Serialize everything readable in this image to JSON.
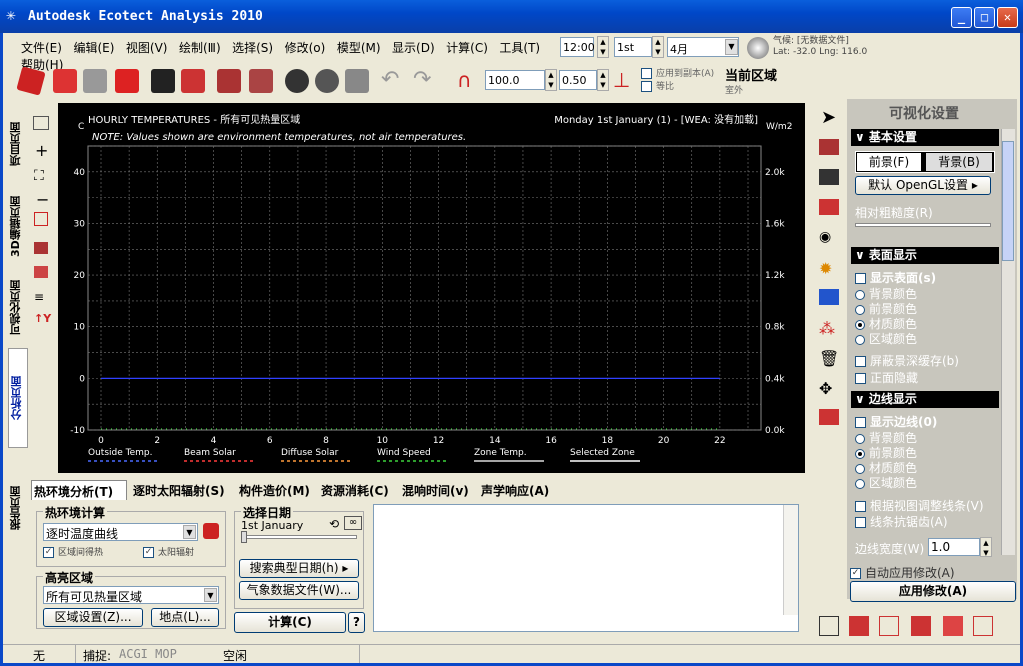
{
  "window": {
    "title": "Autodesk Ecotect Analysis 2010",
    "min": "_",
    "max": "□",
    "close": "✕"
  },
  "menu": [
    "文件(E)",
    "编辑(E)",
    "视图(V)",
    "绘制(Ⅲ)",
    "选择(S)",
    "修改(o)",
    "模型(M)",
    "显示(D)",
    "计算(C)",
    "工具(T)",
    "帮助(H)"
  ],
  "time": {
    "hour": "12:00",
    "day": "1st",
    "month": "4月"
  },
  "weather": {
    "line1": "气候: [无数据文件]",
    "line2": "Lat: -32.0   Lng: 116.0"
  },
  "toolbar2": {
    "value1": "100.0",
    "value2": "0.50",
    "opt1": "应用到副本(A)",
    "opt2": "等比",
    "zone_label": "当前区域",
    "zone_sub": "室外"
  },
  "left_tabs": [
    "项目页面",
    "3D编辑页面",
    "可视化页面",
    "分析页面",
    "报告页面"
  ],
  "chart": {
    "title": "HOURLY TEMPERATURES - 所有可见热量区域",
    "date": "Monday 1st January (1) - [WEA: 没有加载]",
    "note": "NOTE: Values shown are environment temperatures, not air temperatures.",
    "yunit_left": "C",
    "yunit_right": "W/m2",
    "left_ticks": [
      "40",
      "30",
      "20",
      "10",
      "0",
      "-10"
    ],
    "right_ticks": [
      "2.0k",
      "1.6k",
      "1.2k",
      "0.8k",
      "0.4k",
      "0.0k"
    ],
    "x_ticks": [
      "0",
      "2",
      "4",
      "6",
      "8",
      "10",
      "12",
      "14",
      "16",
      "18",
      "20",
      "22"
    ],
    "legend": [
      {
        "name": "Outside Temp.",
        "color": "#4a6bff"
      },
      {
        "name": "Beam Solar",
        "color": "#ff3c3c"
      },
      {
        "name": "Diffuse Solar",
        "color": "#ff9a3c"
      },
      {
        "name": "Wind Speed",
        "color": "#3cd23c"
      },
      {
        "name": "Zone Temp.",
        "color": "#dcdcdc"
      },
      {
        "name": "Selected Zone",
        "color": "#ffffff"
      }
    ]
  },
  "chart_data": {
    "type": "line",
    "title": "HOURLY TEMPERATURES - 所有可见热量区域",
    "x": [
      0,
      2,
      4,
      6,
      8,
      10,
      12,
      14,
      16,
      18,
      20,
      22
    ],
    "ylim": [
      -10,
      45
    ],
    "y2lim": [
      0,
      2200
    ],
    "series": [
      {
        "name": "Outside Temp.",
        "values": [
          0,
          0,
          0,
          0,
          0,
          0,
          0,
          0,
          0,
          0,
          0,
          0
        ]
      },
      {
        "name": "Wind Speed",
        "values": [
          0,
          0,
          0,
          0,
          0,
          0,
          0,
          0,
          0,
          0,
          0,
          0
        ]
      }
    ]
  },
  "bottom_tabs": [
    "热环境分析(T)",
    "逐时太阳辐射(S)",
    "构件造价(M)",
    "资源消耗(C)",
    "混响时间(v)",
    "声学响应(A)"
  ],
  "thermal": {
    "label": "热环境计算",
    "select": "逐时温度曲线",
    "chk1": "区域间得热",
    "chk2": "太阳辐射"
  },
  "highlight": {
    "label": "高亮区域",
    "select": "所有可见热量区域",
    "btn1": "区域设置(Z)...",
    "btn2": "地点(L)..."
  },
  "date_sel": {
    "label": "选择日期",
    "date": "1st January",
    "btn1": "搜索典型日期(h)",
    "btn2": "气象数据文件(W)...",
    "calc": "计算(C)",
    "help": "?"
  },
  "right_panel": {
    "title": "可视化设置",
    "basic": "基本设置",
    "fg": "前景(F)",
    "bg": "背景(B)",
    "opengl": "默认 OpenGL设置",
    "rough": "相对粗糙度(R)",
    "surface": "表面显示",
    "show_surface": "显示表面(s)",
    "s_opts": [
      "背景颜色",
      "前景颜色",
      "材质颜色",
      "区域颜色"
    ],
    "depth": "屏蔽景深缓存(b)",
    "front": "正面隐藏",
    "edge": "边线显示",
    "show_edge": "显示边线(0)",
    "e_opts": [
      "背景颜色",
      "前景颜色",
      "材质颜色",
      "区域颜色"
    ],
    "adj": "根据视图调整线条(V)",
    "anti": "线条抗锯齿(A)",
    "width_label": "边线宽度(W)",
    "width": "1.0",
    "auto": "自动应用修改(A)",
    "apply": "应用修改(A)"
  },
  "status": {
    "left": "无",
    "snap": "捕捉:",
    "snap_keys": "ACGI  MOP",
    "mode": "空闲"
  }
}
